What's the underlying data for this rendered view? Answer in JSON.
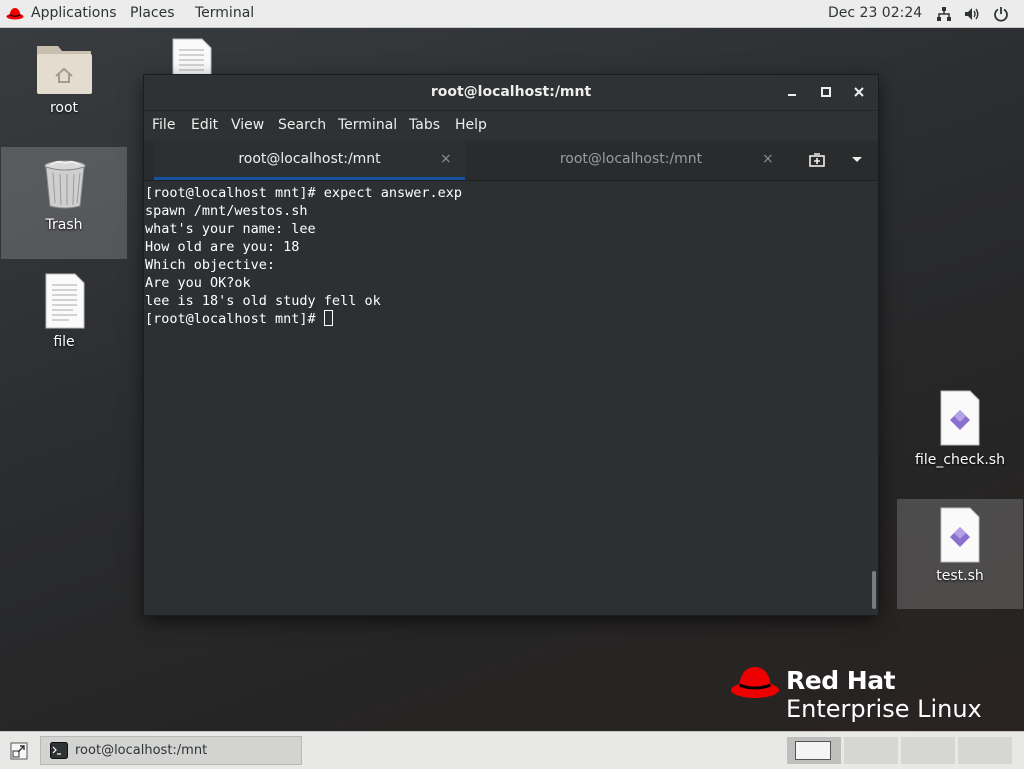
{
  "topbar": {
    "applications": "Applications",
    "places": "Places",
    "terminal": "Terminal",
    "clock": "Dec 23  02:24"
  },
  "desktop": {
    "icons": [
      {
        "label": "root",
        "icon": "home-folder-icon"
      },
      {
        "label": "Trash",
        "icon": "trash-icon"
      },
      {
        "label": "file",
        "icon": "text-file-icon"
      },
      {
        "label": "file_check.sh",
        "icon": "script-file-icon"
      },
      {
        "label": "test.sh",
        "icon": "script-file-icon"
      }
    ]
  },
  "window": {
    "title": "root@localhost:/mnt",
    "menu": [
      "File",
      "Edit",
      "View",
      "Search",
      "Terminal",
      "Tabs",
      "Help"
    ],
    "tabs": [
      {
        "label": "root@localhost:/mnt",
        "active": true
      },
      {
        "label": "root@localhost:/mnt",
        "active": false
      }
    ],
    "close_glyph": "×",
    "terminal_lines": [
      "[root@localhost mnt]# expect answer.exp",
      "spawn /mnt/westos.sh",
      "what's your name: lee",
      "How old are you: 18",
      "Which objective:",
      "Are you OK?ok",
      "lee is 18's old study fell ok",
      "[root@localhost mnt]# "
    ]
  },
  "branding": {
    "line1": "Red Hat",
    "line2": "Enterprise Linux",
    "red": "#ee0000"
  },
  "taskbar": {
    "window_item": "root@localhost:/mnt",
    "workspaces": 4,
    "active_workspace": 1
  }
}
